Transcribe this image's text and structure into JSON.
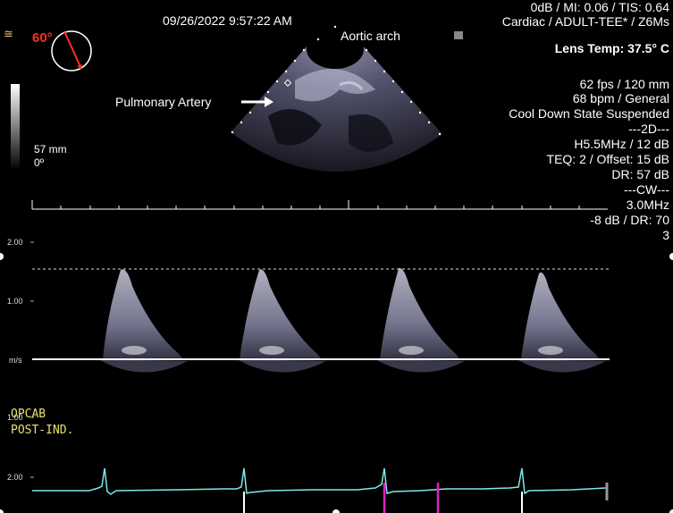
{
  "header": {
    "datetime": "09/26/2022 9:57:22 AM",
    "power": "0dB / MI: 0.06 / TIS: 0.64",
    "preset": "Cardiac / ADULT-TEE* / Z6Ms",
    "lens_temp": "Lens Temp: 37.5° C"
  },
  "probe": {
    "angle": "60°"
  },
  "scale": {
    "depth": "57 mm",
    "tilt": "0º"
  },
  "annotations": {
    "aortic_arch": "Aortic arch",
    "pulmonary_artery": "Pulmonary Artery"
  },
  "params": [
    "62 fps / 120 mm",
    "68 bpm / General",
    "Cool Down State Suspended",
    "---2D---",
    "H5.5MHz / 12 dB",
    "TEQ: 2 / Offset: 15 dB",
    "DR: 57 dB",
    "---CW---",
    "3.0MHz",
    "-8 dB / DR: 70",
    "3"
  ],
  "doppler_axis": {
    "top": "2.00",
    "mid": "1.00",
    "unit": "m/s",
    "bottom": "1.00"
  },
  "study_labels": [
    "OPCAB",
    "POST-IND."
  ],
  "ecg": {
    "label": "2.00"
  },
  "colors": {
    "angle": "#ff3020",
    "ecg_trace": "#7fe8e8",
    "marker_magenta": "#e020c0",
    "label_yellow": "#e8e070"
  }
}
